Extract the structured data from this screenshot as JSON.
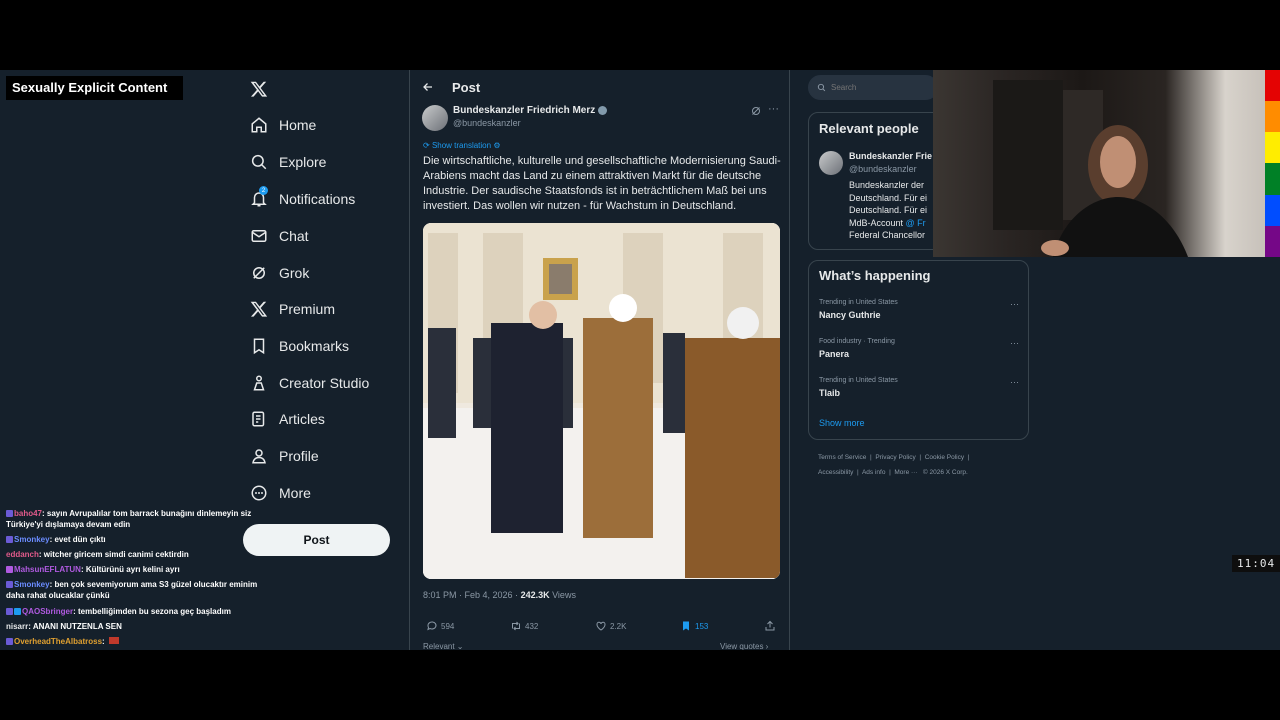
{
  "overlay": {
    "explicit_badge": "Sexually Explicit Content",
    "chat": [
      {
        "user": "baho47",
        "color": "#e05a8a",
        "text": "sayın Avrupalılar tom barrack bunağını dinlemeyin siz Türkiye'yi dışlamaya devam edin"
      },
      {
        "user": "Smonkey",
        "color": "#6b8cff",
        "text": "evet dün çıktı"
      },
      {
        "user": "eddanch",
        "color": "#e05a8a",
        "text": "witcher giricem simdi canimi cektirdin"
      },
      {
        "user": "MahsunEFLATUN",
        "color": "#b05ae0",
        "text": "Kültürünü ayrı kelini ayrı"
      },
      {
        "user": "Smonkey",
        "color": "#6b8cff",
        "text": "ben çok sevemiyorum ama S3 güzel olucaktır eminim daha rahat olucaklar çünkü"
      },
      {
        "user": "QAOSbringer",
        "color": "#b05ae0",
        "text": "tembelliğimden bu sezona geç başladım"
      },
      {
        "user": "nisarr",
        "color": "#e7e9ea",
        "text": "ANANI NUTZENLA SEN"
      },
      {
        "user": "OverheadTheAlbatross",
        "color": "#e0a030",
        "text": ""
      }
    ],
    "clock": "11:04"
  },
  "nav": {
    "items": [
      {
        "label": "Home",
        "icon": "home-icon"
      },
      {
        "label": "Explore",
        "icon": "search-icon"
      },
      {
        "label": "Notifications",
        "icon": "bell-icon"
      },
      {
        "label": "Chat",
        "icon": "mail-icon"
      },
      {
        "label": "Grok",
        "icon": "grok-icon"
      },
      {
        "label": "Premium",
        "icon": "x-icon"
      },
      {
        "label": "Bookmarks",
        "icon": "bookmark-icon"
      },
      {
        "label": "Creator Studio",
        "icon": "creator-icon"
      },
      {
        "label": "Articles",
        "icon": "articles-icon"
      },
      {
        "label": "Profile",
        "icon": "person-icon"
      },
      {
        "label": "More",
        "icon": "more-icon"
      }
    ],
    "notification_count": "2",
    "post_button": "Post"
  },
  "post": {
    "header_title": "Post",
    "author_name": "Bundeskanzler Friedrich Merz",
    "author_handle": "@bundeskanzler",
    "show_translation": "Show translation",
    "text": "Die wirtschaftliche, kulturelle und gesellschaftliche Modernisierung Saudi-Arabiens macht das Land zu einem attraktiven Markt für die deutsche Industrie. Der saudische Staatsfonds ist in beträchtlichem Maß bei uns investiert. Das wollen wir nutzen - für Wachstum in Deutschland.",
    "timestamp": "8:01 PM · Feb 4, 2026 · ",
    "views_count": "242.3K",
    "views_label": " Views",
    "replies": "594",
    "reposts": "432",
    "likes": "2.2K",
    "bookmarks": "153",
    "relevant_peek": "Relevant ⌄",
    "view_quotes_peek": "View quotes ›"
  },
  "right": {
    "search_placeholder": "Search",
    "relevant_people_title": "Relevant people",
    "person_name": "Bundeskanzler Frie",
    "person_handle": "@bundeskanzler",
    "person_bio_lines": [
      "Bundeskanzler der",
      "Deutschland. Für ei",
      "Deutschland. Für ei",
      "MdB-Account",
      "Federal Chancellor"
    ],
    "person_bio_link": "@ Fr",
    "whats_happening_title": "What’s happening",
    "trends": [
      {
        "category": "Trending in United States",
        "name": "Nancy Guthrie"
      },
      {
        "category": "Food industry · Trending",
        "name": "Panera"
      },
      {
        "category": "Trending in United States",
        "name": "Tlaib"
      }
    ],
    "show_more": "Show more",
    "footer_row1": [
      "Terms of Service",
      "Privacy Policy",
      "Cookie Policy"
    ],
    "footer_row2": [
      "Accessibility",
      "Ads info",
      "More ···",
      "© 2026 X Corp."
    ]
  },
  "colors": {
    "background": "#15202b",
    "accent": "#1d9bf0",
    "border": "#38444d",
    "muted": "#8b98a5",
    "pride": [
      "#e40303",
      "#ff8c00",
      "#ffed00",
      "#008026",
      "#004dff",
      "#750787"
    ]
  }
}
